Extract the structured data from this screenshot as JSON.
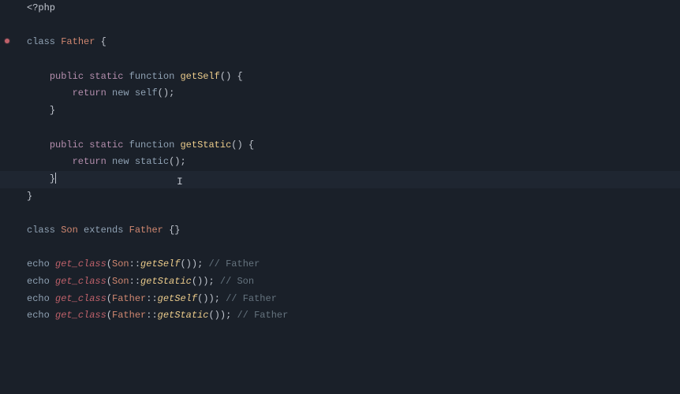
{
  "gutter": {
    "marker_line": 3
  },
  "code": {
    "php_open": "<?php",
    "class_kw": "class",
    "father": "Father",
    "son": "Son",
    "extends_kw": "extends",
    "public_kw": "public",
    "static_kw": "static",
    "function_kw": "function",
    "getSelf": "getSelf",
    "getStatic": "getStatic",
    "return_kw": "return",
    "new_kw": "new",
    "self_kw": "self",
    "static_call": "static",
    "echo_kw": "echo",
    "get_class": "get_class",
    "comment_father": "// Father",
    "comment_son": "// Son",
    "lbrace": "{",
    "rbrace": "}",
    "rbrace_cursor": "}",
    "lparen": "(",
    "rparen": ")",
    "empty_parens": "()",
    "semi": ";",
    "scope": "::",
    "empty_braces": "{}"
  },
  "cursor": {
    "line": 11
  }
}
